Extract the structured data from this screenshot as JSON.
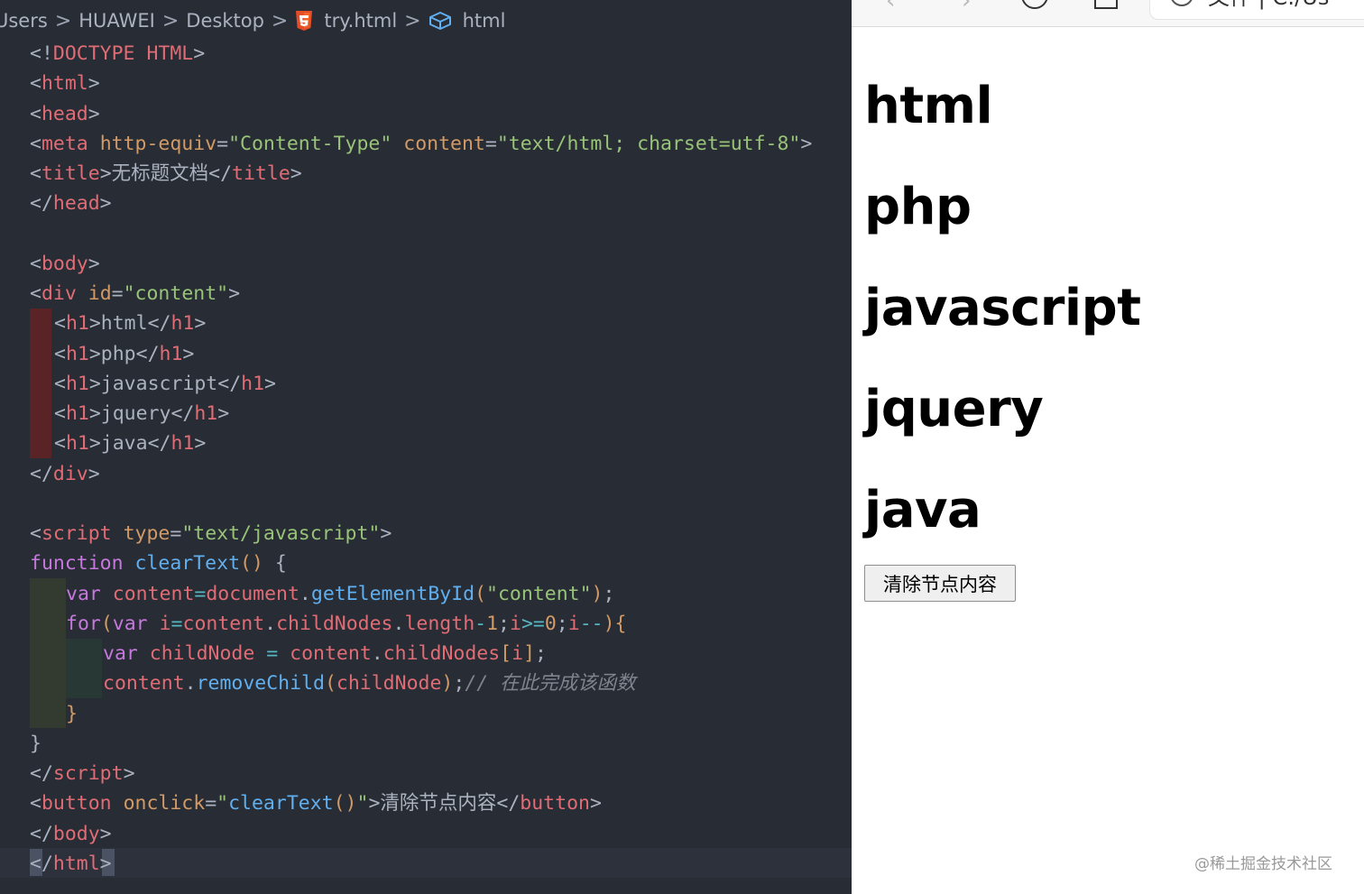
{
  "breadcrumb": {
    "items": [
      "Users",
      "HUAWEI",
      "Desktop",
      "try.html",
      "html"
    ],
    "separator": ">"
  },
  "code_lines": [
    {
      "indent": 0,
      "tokens": [
        [
          "punc",
          "<!"
        ],
        [
          "tag",
          "DOCTYPE HTML"
        ],
        [
          "punc",
          ">"
        ]
      ]
    },
    {
      "indent": 0,
      "tokens": [
        [
          "punc",
          "<"
        ],
        [
          "tag",
          "html"
        ],
        [
          "punc",
          ">"
        ]
      ]
    },
    {
      "indent": 0,
      "tokens": [
        [
          "punc",
          "<"
        ],
        [
          "tag",
          "head"
        ],
        [
          "punc",
          ">"
        ]
      ]
    },
    {
      "indent": 0,
      "tokens": [
        [
          "punc",
          "<"
        ],
        [
          "tag",
          "meta"
        ],
        [
          "text",
          " "
        ],
        [
          "attr",
          "http-equiv"
        ],
        [
          "punc",
          "="
        ],
        [
          "str",
          "\"Content-Type\""
        ],
        [
          "text",
          " "
        ],
        [
          "attr",
          "content"
        ],
        [
          "punc",
          "="
        ],
        [
          "str",
          "\"text/html; charset=utf-8\""
        ],
        [
          "punc",
          ">"
        ]
      ]
    },
    {
      "indent": 0,
      "tokens": [
        [
          "punc",
          "<"
        ],
        [
          "tag",
          "title"
        ],
        [
          "punc",
          ">"
        ],
        [
          "text",
          "无标题文档"
        ],
        [
          "punc",
          "</"
        ],
        [
          "tag",
          "title"
        ],
        [
          "punc",
          ">"
        ]
      ]
    },
    {
      "indent": 0,
      "tokens": [
        [
          "punc",
          "</"
        ],
        [
          "tag",
          "head"
        ],
        [
          "punc",
          ">"
        ]
      ]
    },
    {
      "indent": 0,
      "tokens": []
    },
    {
      "indent": 0,
      "tokens": [
        [
          "punc",
          "<"
        ],
        [
          "tag",
          "body"
        ],
        [
          "punc",
          ">"
        ]
      ]
    },
    {
      "indent": 0,
      "tokens": [
        [
          "punc",
          "<"
        ],
        [
          "tag",
          "div"
        ],
        [
          "text",
          " "
        ],
        [
          "attr",
          "id"
        ],
        [
          "punc",
          "="
        ],
        [
          "str",
          "\"content\""
        ],
        [
          "punc",
          ">"
        ]
      ]
    },
    {
      "indent": 1,
      "tokens": [
        [
          "punc",
          "<"
        ],
        [
          "tag",
          "h1"
        ],
        [
          "punc",
          ">"
        ],
        [
          "text",
          "html"
        ],
        [
          "punc",
          "</"
        ],
        [
          "tag",
          "h1"
        ],
        [
          "punc",
          ">"
        ]
      ]
    },
    {
      "indent": 1,
      "tokens": [
        [
          "punc",
          "<"
        ],
        [
          "tag",
          "h1"
        ],
        [
          "punc",
          ">"
        ],
        [
          "text",
          "php"
        ],
        [
          "punc",
          "</"
        ],
        [
          "tag",
          "h1"
        ],
        [
          "punc",
          ">"
        ]
      ]
    },
    {
      "indent": 1,
      "tokens": [
        [
          "punc",
          "<"
        ],
        [
          "tag",
          "h1"
        ],
        [
          "punc",
          ">"
        ],
        [
          "text",
          "javascript"
        ],
        [
          "punc",
          "</"
        ],
        [
          "tag",
          "h1"
        ],
        [
          "punc",
          ">"
        ]
      ]
    },
    {
      "indent": 1,
      "tokens": [
        [
          "punc",
          "<"
        ],
        [
          "tag",
          "h1"
        ],
        [
          "punc",
          ">"
        ],
        [
          "text",
          "jquery"
        ],
        [
          "punc",
          "</"
        ],
        [
          "tag",
          "h1"
        ],
        [
          "punc",
          ">"
        ]
      ]
    },
    {
      "indent": 1,
      "tokens": [
        [
          "punc",
          "<"
        ],
        [
          "tag",
          "h1"
        ],
        [
          "punc",
          ">"
        ],
        [
          "text",
          "java"
        ],
        [
          "punc",
          "</"
        ],
        [
          "tag",
          "h1"
        ],
        [
          "punc",
          ">"
        ]
      ]
    },
    {
      "indent": 0,
      "tokens": [
        [
          "punc",
          "</"
        ],
        [
          "tag",
          "div"
        ],
        [
          "punc",
          ">"
        ]
      ]
    },
    {
      "indent": 0,
      "tokens": []
    },
    {
      "indent": 0,
      "tokens": [
        [
          "punc",
          "<"
        ],
        [
          "tag",
          "script"
        ],
        [
          "text",
          " "
        ],
        [
          "attr",
          "type"
        ],
        [
          "punc",
          "="
        ],
        [
          "str",
          "\"text/javascript\""
        ],
        [
          "punc",
          ">"
        ]
      ]
    },
    {
      "indent": 0,
      "tokens": [
        [
          "kw",
          "function"
        ],
        [
          "text",
          " "
        ],
        [
          "fn",
          "clearText"
        ],
        [
          "attr",
          "()"
        ],
        [
          "text",
          " "
        ],
        [
          "punc",
          "{"
        ]
      ]
    },
    {
      "indent": 2,
      "tokens": [
        [
          "kw",
          "var"
        ],
        [
          "text",
          " "
        ],
        [
          "var",
          "content"
        ],
        [
          "op",
          "="
        ],
        [
          "var",
          "document"
        ],
        [
          "punc",
          "."
        ],
        [
          "fn",
          "getElementById"
        ],
        [
          "attr",
          "("
        ],
        [
          "str",
          "\"content\""
        ],
        [
          "attr",
          ")"
        ],
        [
          "punc",
          ";"
        ]
      ]
    },
    {
      "indent": 2,
      "tokens": [
        [
          "kw",
          "for"
        ],
        [
          "attr",
          "("
        ],
        [
          "kw",
          "var"
        ],
        [
          "text",
          " "
        ],
        [
          "var",
          "i"
        ],
        [
          "op",
          "="
        ],
        [
          "var",
          "content"
        ],
        [
          "punc",
          "."
        ],
        [
          "var",
          "childNodes"
        ],
        [
          "punc",
          "."
        ],
        [
          "var",
          "length"
        ],
        [
          "op",
          "-"
        ],
        [
          "num",
          "1"
        ],
        [
          "punc",
          ";"
        ],
        [
          "var",
          "i"
        ],
        [
          "op",
          ">="
        ],
        [
          "num",
          "0"
        ],
        [
          "punc",
          ";"
        ],
        [
          "var",
          "i"
        ],
        [
          "op",
          "--"
        ],
        [
          "attr",
          ")"
        ],
        [
          "attr",
          "{"
        ]
      ]
    },
    {
      "indent": 3,
      "tokens": [
        [
          "kw",
          "var"
        ],
        [
          "text",
          " "
        ],
        [
          "var",
          "childNode"
        ],
        [
          "text",
          " "
        ],
        [
          "op",
          "="
        ],
        [
          "text",
          " "
        ],
        [
          "var",
          "content"
        ],
        [
          "punc",
          "."
        ],
        [
          "var",
          "childNodes"
        ],
        [
          "attr",
          "["
        ],
        [
          "var",
          "i"
        ],
        [
          "attr",
          "]"
        ],
        [
          "punc",
          ";"
        ]
      ]
    },
    {
      "indent": 3,
      "tokens": [
        [
          "var",
          "content"
        ],
        [
          "punc",
          "."
        ],
        [
          "fn",
          "removeChild"
        ],
        [
          "attr",
          "("
        ],
        [
          "var",
          "childNode"
        ],
        [
          "attr",
          ")"
        ],
        [
          "punc",
          ";"
        ],
        [
          "cmt",
          "// 在此完成该函数"
        ]
      ]
    },
    {
      "indent": 2,
      "tokens": [
        [
          "attr",
          "}"
        ]
      ]
    },
    {
      "indent": 0,
      "tokens": [
        [
          "punc",
          "}"
        ]
      ]
    },
    {
      "indent": 0,
      "tokens": [
        [
          "punc",
          "</"
        ],
        [
          "tag",
          "script"
        ],
        [
          "punc",
          ">"
        ]
      ]
    },
    {
      "indent": 0,
      "tokens": [
        [
          "punc",
          "<"
        ],
        [
          "tag",
          "button"
        ],
        [
          "text",
          " "
        ],
        [
          "attr",
          "onclick"
        ],
        [
          "punc",
          "="
        ],
        [
          "str",
          "\""
        ],
        [
          "fn",
          "clearText"
        ],
        [
          "attr",
          "()"
        ],
        [
          "str",
          "\""
        ],
        [
          "punc",
          ">"
        ],
        [
          "text",
          "清除节点内容"
        ],
        [
          "punc",
          "</"
        ],
        [
          "tag",
          "button"
        ],
        [
          "punc",
          ">"
        ]
      ]
    },
    {
      "indent": 0,
      "tokens": [
        [
          "punc",
          "</"
        ],
        [
          "tag",
          "body"
        ],
        [
          "punc",
          ">"
        ]
      ]
    },
    {
      "indent": 0,
      "tokens": [
        [
          "punc",
          "</"
        ],
        [
          "tag",
          "html"
        ],
        [
          "punc",
          ">"
        ]
      ]
    }
  ],
  "browser": {
    "address_text": "文件  |  C:/Us",
    "headings": [
      "html",
      "php",
      "javascript",
      "jquery",
      "java"
    ],
    "button_label": "清除节点内容"
  },
  "watermark": "@稀土掘金技术社区",
  "colors": {
    "editor_bg": "#282c34",
    "tag": "#e06c75",
    "attr": "#d19a66",
    "string": "#98c379",
    "keyword": "#c678dd",
    "function": "#61afef",
    "comment": "#7f848e"
  }
}
